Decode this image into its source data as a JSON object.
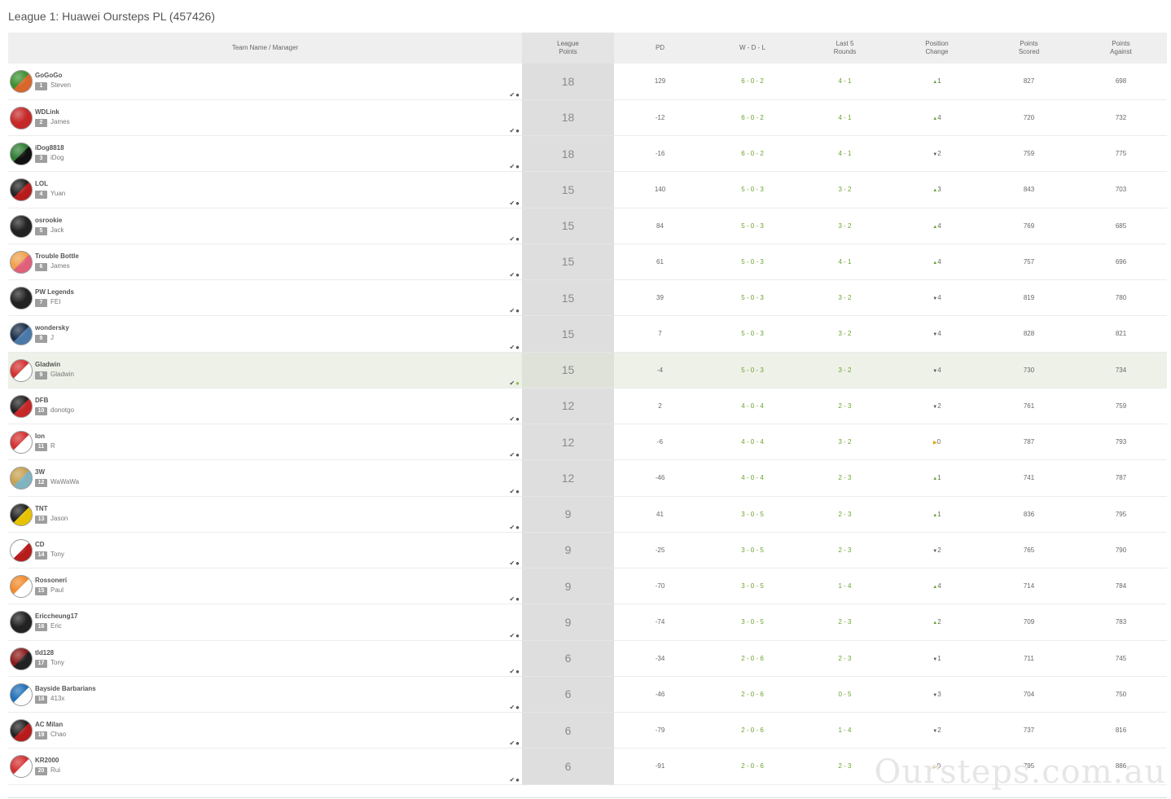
{
  "page": {
    "title": "League 1: Huawei Oursteps PL (457426)",
    "watermark": "Oursteps.com.au"
  },
  "headers": {
    "team": "Team Name / Manager",
    "league_points_1": "League",
    "league_points_2": "Points",
    "pd": "PD",
    "wdl": "W - D - L",
    "last5_1": "Last 5",
    "last5_2": "Rounds",
    "poschange_1": "Position",
    "poschange_2": "Change",
    "scored_1": "Points",
    "scored_2": "Scored",
    "against_1": "Points",
    "against_2": "Against"
  },
  "icons": {
    "check": "check-icon",
    "person": "user-icon",
    "up": "up-arrow-icon",
    "down": "down-arrow-icon",
    "same": "right-arrow-icon"
  },
  "colors": {
    "green": "#6aa22c",
    "highlight_row": "#eef1e8",
    "yellow": "#e0a000"
  },
  "rows": [
    {
      "team": "GoGoGo",
      "rank": "1",
      "manager": "Steven",
      "lp": "18",
      "pd": "129",
      "wdl": "6 - 0 - 2",
      "last5": "4 - 1",
      "dir": "up",
      "pc": "1",
      "scored": "827",
      "against": "698",
      "c1": "#3a8f2f",
      "c2": "#d9662a"
    },
    {
      "team": "WDLink",
      "rank": "2",
      "manager": "James",
      "lp": "18",
      "pd": "-12",
      "wdl": "6 - 0 - 2",
      "last5": "4 - 1",
      "dir": "up",
      "pc": "4",
      "scored": "720",
      "against": "732",
      "c1": "#c62828",
      "c2": "#c62828"
    },
    {
      "team": "iDog8818",
      "rank": "3",
      "manager": "iDog",
      "lp": "18",
      "pd": "-16",
      "wdl": "6 - 0 - 2",
      "last5": "4 - 1",
      "dir": "down",
      "pc": "2",
      "scored": "759",
      "against": "775",
      "c1": "#2e7d32",
      "c2": "#111111"
    },
    {
      "team": "LOL",
      "rank": "4",
      "manager": "Yuan",
      "lp": "15",
      "pd": "140",
      "wdl": "5 - 0 - 3",
      "last5": "3 - 2",
      "dir": "up",
      "pc": "3",
      "scored": "843",
      "against": "703",
      "c1": "#222222",
      "c2": "#b71c1c"
    },
    {
      "team": "osrookie",
      "rank": "5",
      "manager": "Jack",
      "lp": "15",
      "pd": "84",
      "wdl": "5 - 0 - 3",
      "last5": "3 - 2",
      "dir": "up",
      "pc": "4",
      "scored": "769",
      "against": "685",
      "c1": "#222222",
      "c2": "#222222"
    },
    {
      "team": "Trouble Bottle",
      "rank": "6",
      "manager": "James",
      "lp": "15",
      "pd": "61",
      "wdl": "5 - 0 - 3",
      "last5": "4 - 1",
      "dir": "up",
      "pc": "4",
      "scored": "757",
      "against": "696",
      "c1": "#f0a04a",
      "c2": "#e0607a"
    },
    {
      "team": "PW Legends",
      "rank": "7",
      "manager": "FEI",
      "lp": "15",
      "pd": "39",
      "wdl": "5 - 0 - 3",
      "last5": "3 - 2",
      "dir": "down",
      "pc": "4",
      "scored": "819",
      "against": "780",
      "c1": "#222222",
      "c2": "#222222"
    },
    {
      "team": "wondersky",
      "rank": "8",
      "manager": "J",
      "lp": "15",
      "pd": "7",
      "wdl": "5 - 0 - 3",
      "last5": "3 - 2",
      "dir": "down",
      "pc": "4",
      "scored": "828",
      "against": "821",
      "c1": "#1c2f4a",
      "c2": "#4a78a8"
    },
    {
      "team": "Gladwin",
      "rank": "9",
      "manager": "Gladwin",
      "lp": "15",
      "pd": "-4",
      "wdl": "5 - 0 - 3",
      "last5": "3 - 2",
      "dir": "down",
      "pc": "4",
      "scored": "730",
      "against": "734",
      "c1": "#d32f2f",
      "c2": "#ffffff",
      "me": true
    },
    {
      "team": "DFB",
      "rank": "10",
      "manager": "donotgo",
      "lp": "12",
      "pd": "2",
      "wdl": "4 - 0 - 4",
      "last5": "2 - 3",
      "dir": "down",
      "pc": "2",
      "scored": "761",
      "against": "759",
      "c1": "#222222",
      "c2": "#c62828"
    },
    {
      "team": "Ion",
      "rank": "11",
      "manager": "R",
      "lp": "12",
      "pd": "-6",
      "wdl": "4 - 0 - 4",
      "last5": "3 - 2",
      "dir": "same",
      "pc": "0",
      "scored": "787",
      "against": "793",
      "c1": "#d32f2f",
      "c2": "#ffffff"
    },
    {
      "team": "3W",
      "rank": "12",
      "manager": "WaWaWa",
      "lp": "12",
      "pd": "-46",
      "wdl": "4 - 0 - 4",
      "last5": "2 - 3",
      "dir": "up",
      "pc": "1",
      "scored": "741",
      "against": "787",
      "c1": "#c8a050",
      "c2": "#7fb3c0"
    },
    {
      "team": "TNT",
      "rank": "13",
      "manager": "Jason",
      "lp": "9",
      "pd": "41",
      "wdl": "3 - 0 - 5",
      "last5": "2 - 3",
      "dir": "up",
      "pc": "1",
      "scored": "836",
      "against": "795",
      "c1": "#222222",
      "c2": "#e6c200"
    },
    {
      "team": "CD",
      "rank": "14",
      "manager": "Tony",
      "lp": "9",
      "pd": "-25",
      "wdl": "3 - 0 - 5",
      "last5": "2 - 3",
      "dir": "down",
      "pc": "2",
      "scored": "765",
      "against": "790",
      "c1": "#ffffff",
      "c2": "#b71c1c"
    },
    {
      "team": "Rossoneri",
      "rank": "15",
      "manager": "Paul",
      "lp": "9",
      "pd": "-70",
      "wdl": "3 - 0 - 5",
      "last5": "1 - 4",
      "dir": "up",
      "pc": "4",
      "scored": "714",
      "against": "784",
      "c1": "#f08a2a",
      "c2": "#ffffff"
    },
    {
      "team": "Ericcheung17",
      "rank": "16",
      "manager": "Eric",
      "lp": "9",
      "pd": "-74",
      "wdl": "3 - 0 - 5",
      "last5": "2 - 3",
      "dir": "up",
      "pc": "2",
      "scored": "709",
      "against": "783",
      "c1": "#222222",
      "c2": "#222222"
    },
    {
      "team": "tld128",
      "rank": "17",
      "manager": "Tony",
      "lp": "6",
      "pd": "-34",
      "wdl": "2 - 0 - 6",
      "last5": "2 - 3",
      "dir": "down",
      "pc": "1",
      "scored": "711",
      "against": "745",
      "c1": "#8b1a1a",
      "c2": "#222222"
    },
    {
      "team": "Bayside Barbarians",
      "rank": "18",
      "manager": "413x",
      "lp": "6",
      "pd": "-46",
      "wdl": "2 - 0 - 6",
      "last5": "0 - 5",
      "dir": "down",
      "pc": "3",
      "scored": "704",
      "against": "750",
      "c1": "#1e6fb8",
      "c2": "#ffffff"
    },
    {
      "team": "AC Milan",
      "rank": "19",
      "manager": "Chao",
      "lp": "6",
      "pd": "-79",
      "wdl": "2 - 0 - 6",
      "last5": "1 - 4",
      "dir": "down",
      "pc": "2",
      "scored": "737",
      "against": "816",
      "c1": "#222222",
      "c2": "#b71c1c"
    },
    {
      "team": "KR2000",
      "rank": "20",
      "manager": "Rui",
      "lp": "6",
      "pd": "-91",
      "wdl": "2 - 0 - 6",
      "last5": "2 - 3",
      "dir": "same",
      "pc": "0",
      "scored": "795",
      "against": "886",
      "c1": "#d32f2f",
      "c2": "#ffffff"
    }
  ]
}
